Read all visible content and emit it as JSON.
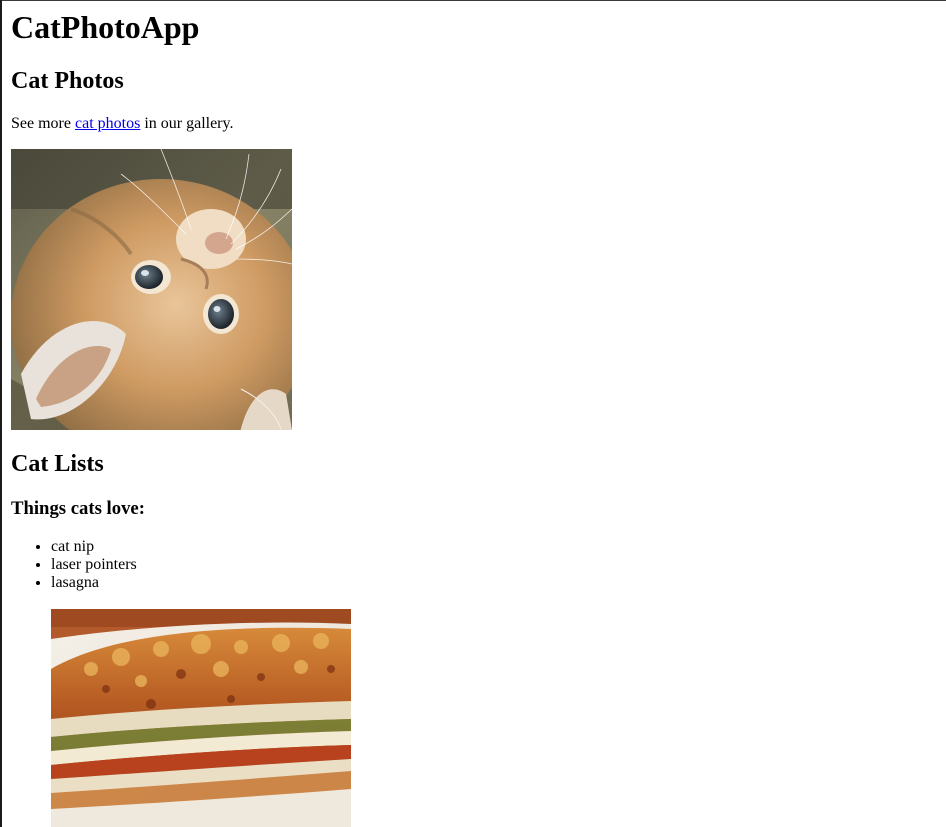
{
  "header": {
    "title": "CatPhotoApp"
  },
  "photos_section": {
    "heading": "Cat Photos",
    "paragraph_before": "See more",
    "link_text": "cat photos",
    "paragraph_after": "in our gallery.",
    "image_alt": "A cute orange cat lying on its back."
  },
  "lists_section": {
    "heading": "Cat Lists",
    "love_heading": "Things cats love:",
    "love_items": [
      "cat nip",
      "laser pointers",
      "lasagna"
    ],
    "lasagna_image_alt": "A slice of lasagna on a plate."
  }
}
